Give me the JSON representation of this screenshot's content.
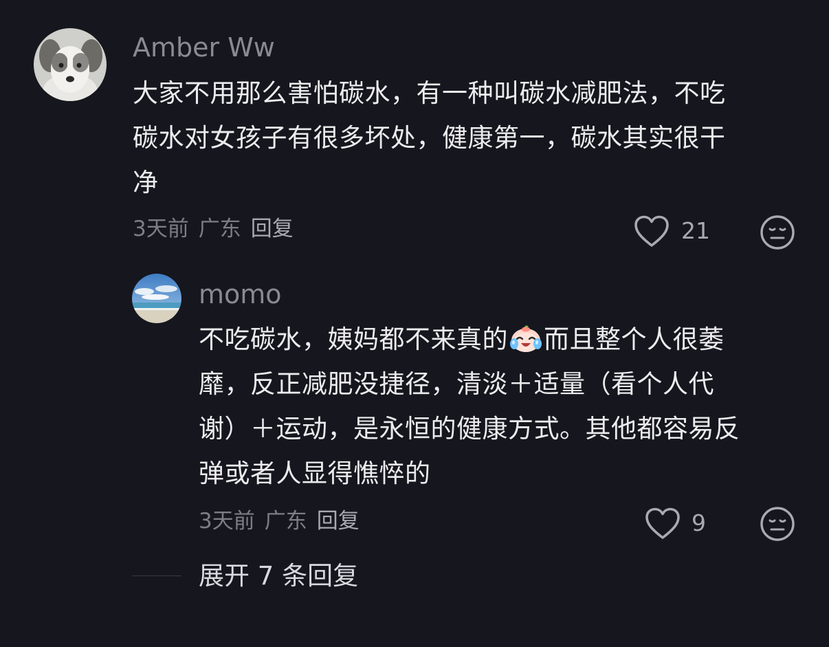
{
  "comments": [
    {
      "user": "Amber Ww",
      "avatar_icon": "dog-avatar",
      "lines": [
        "大家不用那么害怕碳水，有一种叫碳水减肥法，不吃",
        "碳水对女孩子有很多坏处，健康第一，碳水其实很干",
        "净"
      ],
      "time": "3天前",
      "location": "广东",
      "reply_label": "回复",
      "like_count": "21"
    }
  ],
  "replies": [
    {
      "user": "momo",
      "avatar_icon": "beach-avatar",
      "line1_a": "不吃碳水，姨妈都不来真的",
      "emoji": "crying-laughing-emoji",
      "line1_b": "而且整个人很萎",
      "lines": [
        "靡，反正减肥没捷径，清淡＋适量（看个人代",
        "谢）＋运动，是永恒的健康方式。其他都容易反",
        "弹或者人显得憔悴的"
      ],
      "time": "3天前",
      "location": "广东",
      "reply_label": "回复",
      "like_count": "9"
    }
  ],
  "expand_label": "展开 7 条回复",
  "colors": {
    "background": "#16161e",
    "username": "#8a8a92",
    "text": "#ececee",
    "meta": "#7d7d85"
  }
}
